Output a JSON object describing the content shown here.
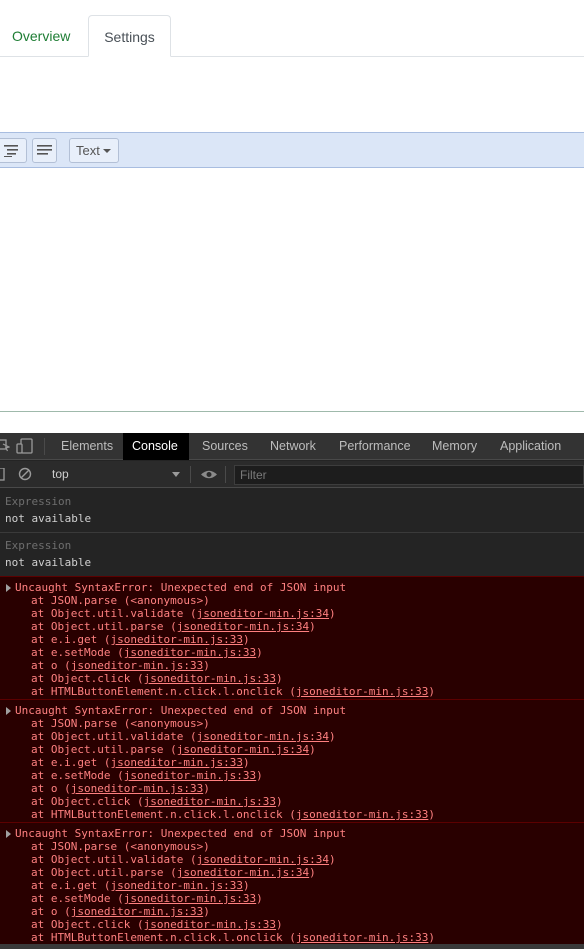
{
  "page_tabs": [
    {
      "label": "Overview"
    },
    {
      "label": "Settings"
    }
  ],
  "editor": {
    "mode_label": "Text"
  },
  "devtools": {
    "tabs": [
      "Elements",
      "Console",
      "Sources",
      "Network",
      "Performance",
      "Memory",
      "Application"
    ],
    "active_tab": "Console",
    "context": "top",
    "filter_placeholder": "Filter",
    "expressions": [
      {
        "label": "Expression",
        "value": "not available"
      },
      {
        "label": "Expression",
        "value": "not available"
      }
    ],
    "errors": [
      {
        "message": "Uncaught SyntaxError: Unexpected end of JSON input",
        "stack": [
          {
            "prefix": "at JSON.parse (<anonymous>)",
            "link": "",
            "suffix": ""
          },
          {
            "prefix": "at Object.util.validate (",
            "link": "jsoneditor-min.js:34",
            "suffix": ")"
          },
          {
            "prefix": "at Object.util.parse (",
            "link": "jsoneditor-min.js:34",
            "suffix": ")"
          },
          {
            "prefix": "at e.i.get (",
            "link": "jsoneditor-min.js:33",
            "suffix": ")"
          },
          {
            "prefix": "at e.setMode (",
            "link": "jsoneditor-min.js:33",
            "suffix": ")"
          },
          {
            "prefix": "at o (",
            "link": "jsoneditor-min.js:33",
            "suffix": ")"
          },
          {
            "prefix": "at Object.click (",
            "link": "jsoneditor-min.js:33",
            "suffix": ")"
          },
          {
            "prefix": "at HTMLButtonElement.n.click.l.onclick (",
            "link": "jsoneditor-min.js:33",
            "suffix": ")"
          }
        ]
      },
      {
        "message": "Uncaught SyntaxError: Unexpected end of JSON input",
        "stack": [
          {
            "prefix": "at JSON.parse (<anonymous>)",
            "link": "",
            "suffix": ""
          },
          {
            "prefix": "at Object.util.validate (",
            "link": "jsoneditor-min.js:34",
            "suffix": ")"
          },
          {
            "prefix": "at Object.util.parse (",
            "link": "jsoneditor-min.js:34",
            "suffix": ")"
          },
          {
            "prefix": "at e.i.get (",
            "link": "jsoneditor-min.js:33",
            "suffix": ")"
          },
          {
            "prefix": "at e.setMode (",
            "link": "jsoneditor-min.js:33",
            "suffix": ")"
          },
          {
            "prefix": "at o (",
            "link": "jsoneditor-min.js:33",
            "suffix": ")"
          },
          {
            "prefix": "at Object.click (",
            "link": "jsoneditor-min.js:33",
            "suffix": ")"
          },
          {
            "prefix": "at HTMLButtonElement.n.click.l.onclick (",
            "link": "jsoneditor-min.js:33",
            "suffix": ")"
          }
        ]
      },
      {
        "message": "Uncaught SyntaxError: Unexpected end of JSON input",
        "stack": [
          {
            "prefix": "at JSON.parse (<anonymous>)",
            "link": "",
            "suffix": ""
          },
          {
            "prefix": "at Object.util.validate (",
            "link": "jsoneditor-min.js:34",
            "suffix": ")"
          },
          {
            "prefix": "at Object.util.parse (",
            "link": "jsoneditor-min.js:34",
            "suffix": ")"
          },
          {
            "prefix": "at e.i.get (",
            "link": "jsoneditor-min.js:33",
            "suffix": ")"
          },
          {
            "prefix": "at e.setMode (",
            "link": "jsoneditor-min.js:33",
            "suffix": ")"
          },
          {
            "prefix": "at o (",
            "link": "jsoneditor-min.js:33",
            "suffix": ")"
          },
          {
            "prefix": "at Object.click (",
            "link": "jsoneditor-min.js:33",
            "suffix": ")"
          },
          {
            "prefix": "at HTMLButtonElement.n.click.l.onclick (",
            "link": "jsoneditor-min.js:33",
            "suffix": ")"
          }
        ]
      }
    ]
  },
  "colors": {
    "tab_green": "#1e7d34",
    "toolbar_blue": "#dbe6f7",
    "error_bg": "#290000",
    "error_text": "#ff8080"
  }
}
